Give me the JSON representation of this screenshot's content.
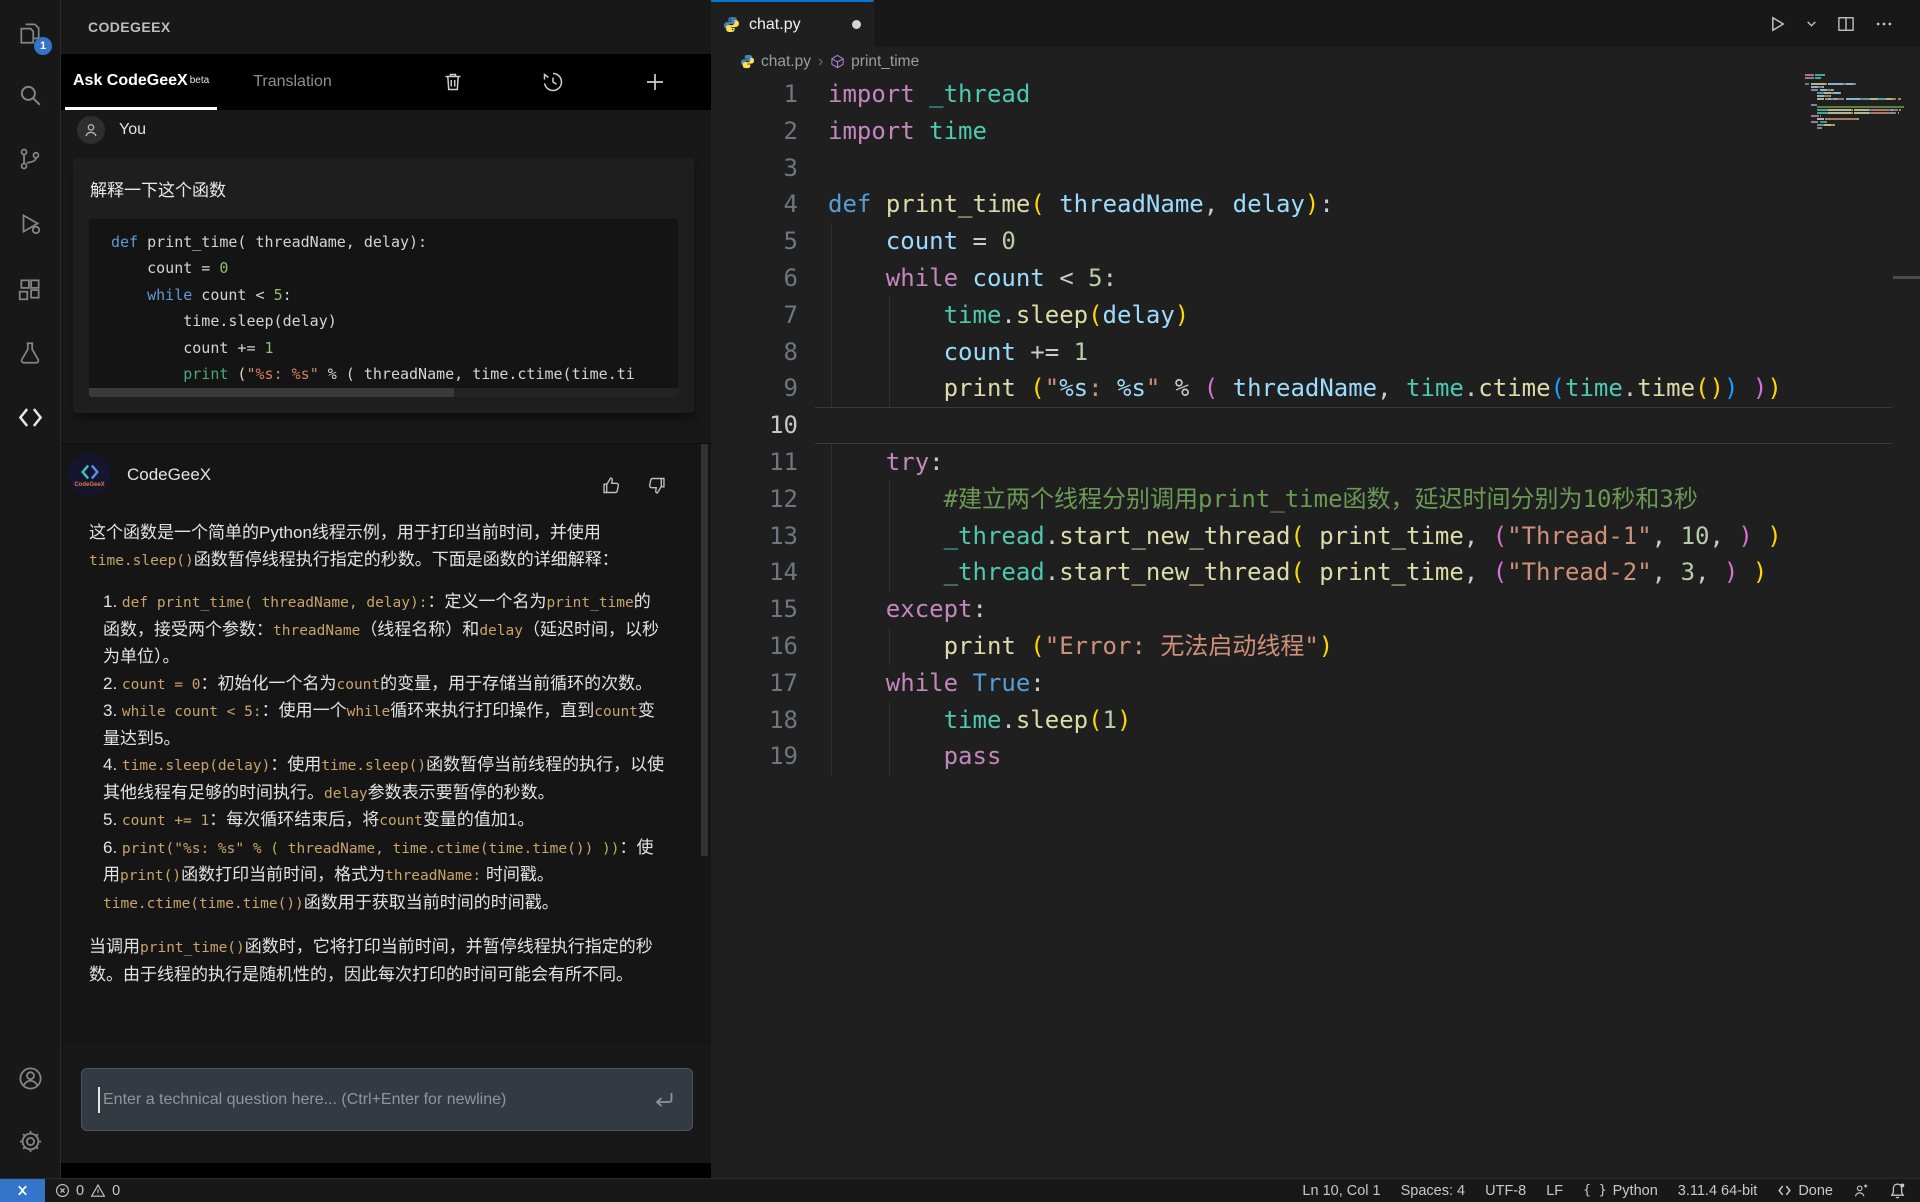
{
  "colors": {
    "tab_accent": "#0078d4",
    "remote_blue": "#3474c9",
    "inline_code": "#c9a36a",
    "panel_bg": "#181818",
    "editor_bg": "#1f1f1f"
  },
  "activity": {
    "badge": "1"
  },
  "panel": {
    "title": "CODEGEEX",
    "tabs": [
      {
        "label": "Ask CodeGeeX",
        "sup": "beta"
      },
      {
        "label": "Translation"
      }
    ]
  },
  "chat": {
    "user": {
      "name": "You",
      "question": "解释一下这个函数",
      "code_lines": [
        [
          [
            "K",
            "def"
          ],
          [
            "P",
            " print_time( threadName, delay):"
          ]
        ],
        [
          [
            "P",
            "    count = "
          ],
          [
            "N",
            "0"
          ]
        ],
        [
          [
            "P",
            "    "
          ],
          [
            "K",
            "while"
          ],
          [
            "P",
            " count < "
          ],
          [
            "N",
            "5"
          ],
          [
            "P",
            ":"
          ]
        ],
        [
          [
            "P",
            "        time.sleep(delay)"
          ]
        ],
        [
          [
            "P",
            "        count += "
          ],
          [
            "N",
            "1"
          ]
        ],
        [
          [
            "P",
            "        "
          ],
          [
            "F",
            "print"
          ],
          [
            "P",
            " ("
          ],
          [
            "S",
            "\""
          ],
          [
            "Q",
            "%s"
          ],
          [
            "S",
            ": "
          ],
          [
            "Q",
            "%s"
          ],
          [
            "S",
            "\""
          ],
          [
            "P",
            " % ( threadName, time.ctime(time.ti"
          ]
        ]
      ]
    },
    "assistant": {
      "name": "CodeGeeX",
      "intro": [
        {
          "t": "这个函数是一个简单的Python线程示例，用于打印当前时间，并使用"
        },
        {
          "t": "time.sleep()",
          "c": 1
        },
        {
          "t": "函数暂停线程执行指定的秒数。下面是函数的详细解释："
        }
      ],
      "items": [
        [
          {
            "t": "def print_time( threadName, delay):",
            "c": 1
          },
          {
            "t": "：定义一个名为"
          },
          {
            "t": "print_time",
            "c": 1
          },
          {
            "t": "的函数，接受两个参数："
          },
          {
            "t": "threadName",
            "c": 1
          },
          {
            "t": "（线程名称）和"
          },
          {
            "t": "delay",
            "c": 1
          },
          {
            "t": "（延迟时间，以秒为单位）。"
          }
        ],
        [
          {
            "t": "count = 0",
            "c": 1
          },
          {
            "t": "：初始化一个名为"
          },
          {
            "t": "count",
            "c": 1
          },
          {
            "t": "的变量，用于存储当前循环的次数。"
          }
        ],
        [
          {
            "t": "while count < 5:",
            "c": 1
          },
          {
            "t": "：使用一个"
          },
          {
            "t": "while",
            "c": 1
          },
          {
            "t": "循环来执行打印操作，直到"
          },
          {
            "t": "count",
            "c": 1
          },
          {
            "t": "变量达到5。"
          }
        ],
        [
          {
            "t": "time.sleep(delay)",
            "c": 1
          },
          {
            "t": "：使用"
          },
          {
            "t": "time.sleep()",
            "c": 1
          },
          {
            "t": "函数暂停当前线程的执行，以使其他线程有足够的时间执行。"
          },
          {
            "t": "delay",
            "c": 1
          },
          {
            "t": "参数表示要暂停的秒数。"
          }
        ],
        [
          {
            "t": "count += 1",
            "c": 1
          },
          {
            "t": "：每次循环结束后，将"
          },
          {
            "t": "count",
            "c": 1
          },
          {
            "t": "变量的值加1。"
          }
        ],
        [
          {
            "t": "print(\"%s: %s\" % ( threadName, time.ctime(time.time()) ))",
            "c": 1
          },
          {
            "t": "：使用"
          },
          {
            "t": "print()",
            "c": 1
          },
          {
            "t": "函数打印当前时间，格式为"
          },
          {
            "t": "threadName:",
            "c": 1
          },
          {
            "t": " 时间戳。"
          },
          {
            "t": "time.ctime(time.time())",
            "c": 1
          },
          {
            "t": "函数用于获取当前时间的时间戳。"
          }
        ]
      ],
      "outro": [
        {
          "t": "当调用"
        },
        {
          "t": "print_time()",
          "c": 1
        },
        {
          "t": "函数时，它将打印当前时间，并暂停线程执行指定的秒数。由于线程的执行是随机性的，因此每次打印的时间可能会有所不同。"
        }
      ]
    }
  },
  "input": {
    "placeholder": "Enter a technical question here... (Ctrl+Enter for newline)"
  },
  "editor": {
    "tab": {
      "filename": "chat.py"
    },
    "breadcrumb": {
      "file": "chat.py",
      "separator": "›",
      "symbol": "print_time"
    },
    "lines": [
      {
        "n": "1",
        "t": [
          [
            "k",
            "import"
          ],
          [
            "p",
            " "
          ],
          [
            "m",
            "_thread"
          ]
        ]
      },
      {
        "n": "2",
        "t": [
          [
            "k",
            "import"
          ],
          [
            "p",
            " "
          ],
          [
            "m",
            "time"
          ]
        ]
      },
      {
        "n": "3",
        "t": []
      },
      {
        "n": "4",
        "t": [
          [
            "d",
            "def"
          ],
          [
            "p",
            " "
          ],
          [
            "f",
            "print_time"
          ],
          [
            "A",
            "("
          ],
          [
            "p",
            " "
          ],
          [
            "v",
            "threadName"
          ],
          [
            "p",
            ", "
          ],
          [
            "v",
            "delay"
          ],
          [
            "A",
            ")"
          ],
          [
            "p",
            ":"
          ]
        ]
      },
      {
        "n": "5",
        "t": [
          [
            "p",
            "    "
          ],
          [
            "v",
            "count"
          ],
          [
            "p",
            " = "
          ],
          [
            "n",
            "0"
          ]
        ]
      },
      {
        "n": "6",
        "t": [
          [
            "p",
            "    "
          ],
          [
            "k",
            "while"
          ],
          [
            "p",
            " "
          ],
          [
            "v",
            "count"
          ],
          [
            "p",
            " < "
          ],
          [
            "n",
            "5"
          ],
          [
            "p",
            ":"
          ]
        ]
      },
      {
        "n": "7",
        "t": [
          [
            "p",
            "        "
          ],
          [
            "m",
            "time"
          ],
          [
            "p",
            "."
          ],
          [
            "f",
            "sleep"
          ],
          [
            "A",
            "("
          ],
          [
            "v",
            "delay"
          ],
          [
            "A",
            ")"
          ]
        ]
      },
      {
        "n": "8",
        "t": [
          [
            "p",
            "        "
          ],
          [
            "v",
            "count"
          ],
          [
            "p",
            " += "
          ],
          [
            "n",
            "1"
          ]
        ]
      },
      {
        "n": "9",
        "t": [
          [
            "p",
            "        "
          ],
          [
            "f",
            "print"
          ],
          [
            "p",
            " "
          ],
          [
            "A",
            "("
          ],
          [
            "s",
            "\""
          ],
          [
            "q",
            "%s"
          ],
          [
            "s",
            ": "
          ],
          [
            "q",
            "%s"
          ],
          [
            "s",
            "\""
          ],
          [
            "p",
            " % "
          ],
          [
            "B",
            "("
          ],
          [
            "p",
            " "
          ],
          [
            "v",
            "threadName"
          ],
          [
            "p",
            ", "
          ],
          [
            "m",
            "time"
          ],
          [
            "p",
            "."
          ],
          [
            "f",
            "ctime"
          ],
          [
            "C",
            "("
          ],
          [
            "m",
            "time"
          ],
          [
            "p",
            "."
          ],
          [
            "f",
            "time"
          ],
          [
            "A",
            "("
          ],
          [
            "A",
            ")"
          ],
          [
            "C",
            ")"
          ],
          [
            "p",
            " "
          ],
          [
            "B",
            ")"
          ],
          [
            "A",
            ")"
          ]
        ]
      },
      {
        "n": "10",
        "t": [],
        "active": true
      },
      {
        "n": "11",
        "t": [
          [
            "p",
            "    "
          ],
          [
            "k",
            "try"
          ],
          [
            "p",
            ":"
          ]
        ]
      },
      {
        "n": "12",
        "t": [
          [
            "p",
            "        "
          ],
          [
            "c",
            "#建立两个线程分别调用print_time函数，延迟时间分别为10秒和3秒"
          ]
        ]
      },
      {
        "n": "13",
        "t": [
          [
            "p",
            "        "
          ],
          [
            "m",
            "_thread"
          ],
          [
            "p",
            "."
          ],
          [
            "f",
            "start_new_thread"
          ],
          [
            "A",
            "("
          ],
          [
            "p",
            " "
          ],
          [
            "f",
            "print_time"
          ],
          [
            "p",
            ", "
          ],
          [
            "B",
            "("
          ],
          [
            "s",
            "\"Thread-1\""
          ],
          [
            "p",
            ", "
          ],
          [
            "n",
            "10"
          ],
          [
            "p",
            ", "
          ],
          [
            "B",
            ")"
          ],
          [
            "p",
            " "
          ],
          [
            "A",
            ")"
          ]
        ]
      },
      {
        "n": "14",
        "t": [
          [
            "p",
            "        "
          ],
          [
            "m",
            "_thread"
          ],
          [
            "p",
            "."
          ],
          [
            "f",
            "start_new_thread"
          ],
          [
            "A",
            "("
          ],
          [
            "p",
            " "
          ],
          [
            "f",
            "print_time"
          ],
          [
            "p",
            ", "
          ],
          [
            "B",
            "("
          ],
          [
            "s",
            "\"Thread-2\""
          ],
          [
            "p",
            ", "
          ],
          [
            "n",
            "3"
          ],
          [
            "p",
            ", "
          ],
          [
            "B",
            ")"
          ],
          [
            "p",
            " "
          ],
          [
            "A",
            ")"
          ]
        ]
      },
      {
        "n": "15",
        "t": [
          [
            "p",
            "    "
          ],
          [
            "k",
            "except"
          ],
          [
            "p",
            ":"
          ]
        ]
      },
      {
        "n": "16",
        "t": [
          [
            "p",
            "        "
          ],
          [
            "f",
            "print"
          ],
          [
            "p",
            " "
          ],
          [
            "A",
            "("
          ],
          [
            "s",
            "\"Error: 无法启动线程\""
          ],
          [
            "A",
            ")"
          ]
        ]
      },
      {
        "n": "17",
        "t": [
          [
            "p",
            "    "
          ],
          [
            "k",
            "while"
          ],
          [
            "p",
            " "
          ],
          [
            "d",
            "True"
          ],
          [
            "p",
            ":"
          ]
        ]
      },
      {
        "n": "18",
        "t": [
          [
            "p",
            "        "
          ],
          [
            "m",
            "time"
          ],
          [
            "p",
            "."
          ],
          [
            "f",
            "sleep"
          ],
          [
            "A",
            "("
          ],
          [
            "n",
            "1"
          ],
          [
            "A",
            ")"
          ]
        ]
      },
      {
        "n": "19",
        "t": [
          [
            "p",
            "        "
          ],
          [
            "k",
            "pass"
          ]
        ]
      }
    ],
    "guides": [
      {
        "u": 0,
        "from": 5,
        "to": 9
      },
      {
        "u": 0,
        "from": 11,
        "to": 19
      },
      {
        "u": 1,
        "from": 7,
        "to": 9
      },
      {
        "u": 1,
        "from": 12,
        "to": 14
      },
      {
        "u": 1,
        "from": 16,
        "to": 16
      },
      {
        "u": 1,
        "from": 18,
        "to": 19
      }
    ]
  },
  "status": {
    "errors": "0",
    "warnings": "0",
    "line_col": "Ln 10, Col 1",
    "spaces": "Spaces: 4",
    "encoding": "UTF-8",
    "eol": "LF",
    "language": "Python",
    "interpreter": "3.11.4 64-bit",
    "codegeex_status": "Done"
  }
}
